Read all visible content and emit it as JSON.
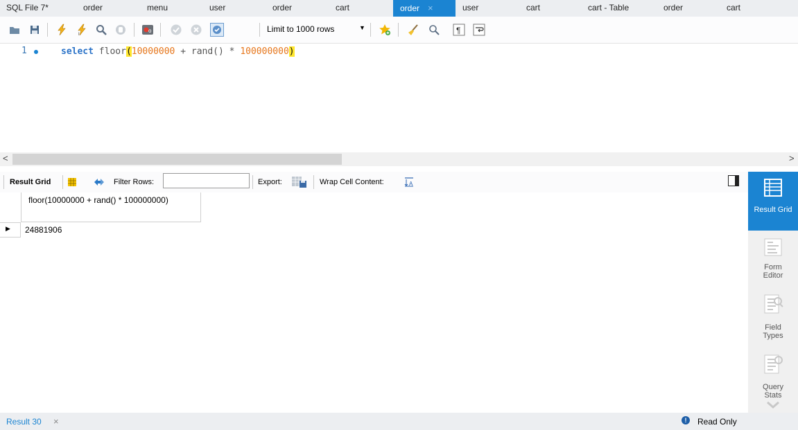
{
  "tabs": [
    {
      "label": "SQL File 7*",
      "active": false
    },
    {
      "label": "order",
      "active": false
    },
    {
      "label": "menu",
      "active": false
    },
    {
      "label": "user",
      "active": false
    },
    {
      "label": "order",
      "active": false
    },
    {
      "label": "cart",
      "active": false
    },
    {
      "label": "order",
      "active": true
    },
    {
      "label": "user",
      "active": false
    },
    {
      "label": "cart",
      "active": false
    },
    {
      "label": "cart - Table",
      "active": false
    },
    {
      "label": "order",
      "active": false
    },
    {
      "label": "cart",
      "active": false
    }
  ],
  "tab_close": "×",
  "toolbar": {
    "limit_label": "Limit to 1000 rows",
    "limit_arrow": "▼"
  },
  "editor": {
    "line_number": "1",
    "code": {
      "keyword": "select",
      "func": "floor",
      "open_paren": "(",
      "num1": "10000000",
      "op1": " + ",
      "func2": "rand()",
      "op2": " * ",
      "num2": "100000000",
      "close_paren": ")"
    }
  },
  "scroll": {
    "left": "<",
    "right": ">"
  },
  "result_toolbar": {
    "result_grid": "Result Grid",
    "filter_rows": "Filter Rows:",
    "filter_value": "",
    "export": "Export:",
    "wrap": "Wrap Cell Content:"
  },
  "grid": {
    "column_header": "floor(10000000 + rand() * 100000000)",
    "row_marker": "▶",
    "value": "24881906"
  },
  "side_panel": {
    "result_grid": "Result Grid",
    "form_editor": "Form Editor",
    "field_types": "Field Types",
    "query_stats": "Query Stats"
  },
  "status": {
    "result_tab": "Result 30",
    "close": "×",
    "info": "!",
    "read_only": "Read Only"
  },
  "colors": {
    "accent": "#1b84d2",
    "number": "#e6761b",
    "keyword": "#2b73c8",
    "paren_highlight": "#ffe62e"
  }
}
